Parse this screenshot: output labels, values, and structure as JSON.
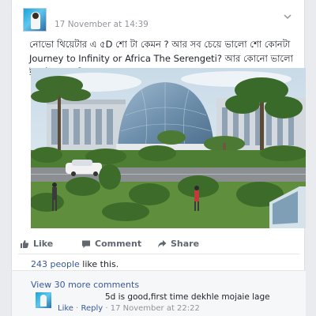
{
  "post": {
    "timestamp": "17 November at 14:39",
    "text": "নোভো থিয়েটার এ ৫D শো টা কেমন ? আর সব চেয়ে ভালো শো কোনটা Journey to Infinity or Africa The Serengeti? আর কোনো ভালো ইভেন্ট আছে কি ?",
    "options_icon": "chevron-down-icon"
  },
  "actions": {
    "like_label": "Like",
    "comment_label": "Comment",
    "share_label": "Share"
  },
  "likes": {
    "count_text": "243 people",
    "suffix": " like this."
  },
  "comments": {
    "view_more": "View 30 more comments",
    "items": [
      {
        "text": "5d is good,first time dekhle mojaie lage",
        "like_label": "Like",
        "separator": " · ",
        "reply_label": "Reply",
        "timestamp": " · 17 November at 22:22"
      }
    ]
  },
  "colors": {
    "link": "#385898",
    "meta": "#90949c",
    "background": "#e9ebee"
  }
}
